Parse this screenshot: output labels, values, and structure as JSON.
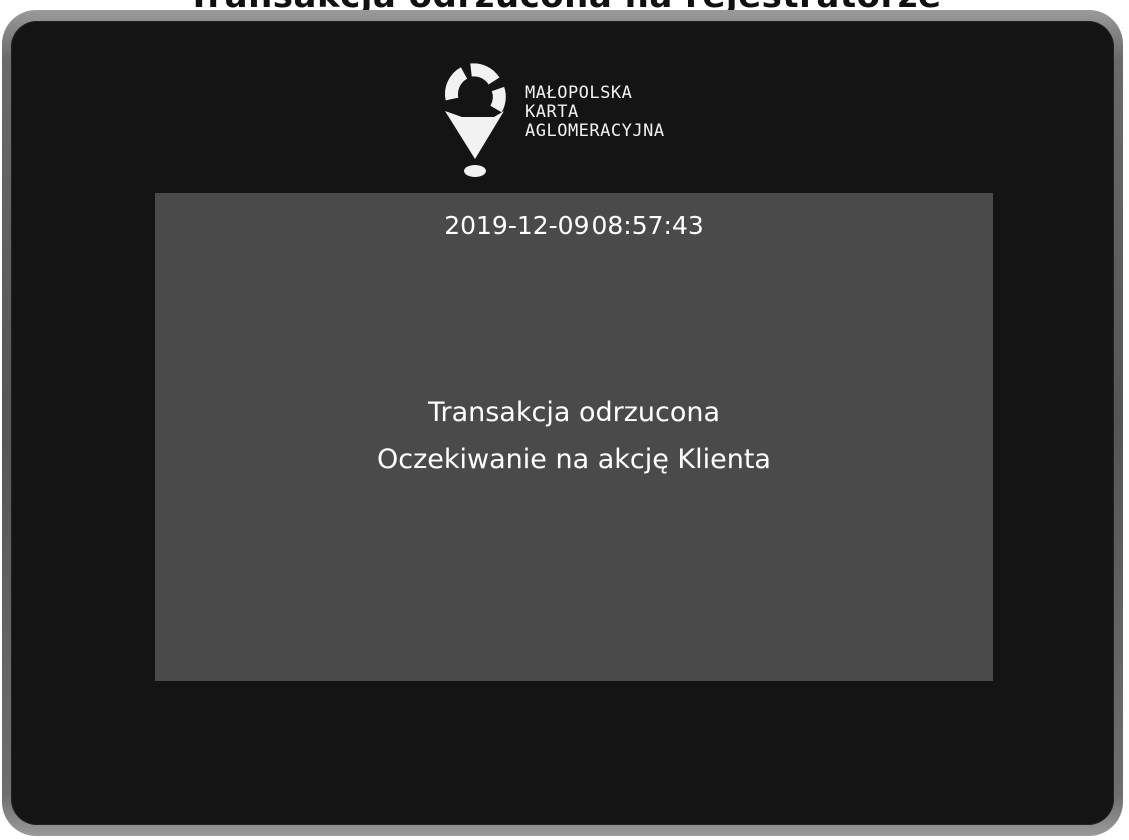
{
  "header": {
    "partial_title": "Transakcja odrzucona na rejestratorze"
  },
  "logo": {
    "line1": "MAŁOPOLSKA",
    "line2": "KARTA",
    "line3": "AGLOMERACYJNA"
  },
  "screen": {
    "date": "2019-12-09",
    "time": "08:57:43",
    "message_line1": "Transakcja odrzucona",
    "message_line2": "Oczekiwanie na akcję Klienta"
  },
  "colors": {
    "bezel": "#141414",
    "screen": "#4a4a4a",
    "text": "#ffffff"
  }
}
